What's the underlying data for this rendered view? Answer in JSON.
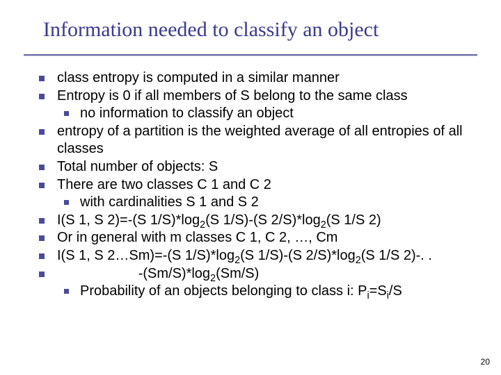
{
  "title": "Information needed to classify an object",
  "bullets": {
    "b1": "class entropy is computed in a similar manner",
    "b2": "Entropy is 0 if all members of S belong to the same class",
    "b2a": "no information to classify an object",
    "b3": "entropy of a partition is the weighted average of all entropies of all classes",
    "b4": "Total number of objects: S",
    "b5": "There are two classes C 1 and C 2",
    "b5a": "with cardinalities S 1 and S 2",
    "b6_html": "I(S 1, S 2)=-(S 1/S)*log<span class=\"sub\">2</span>(S 1/S)-(S 2/S)*log<span class=\"sub\">2</span>(S 1/S 2)",
    "b7": "Or in general with m classes C 1, C 2, …, Cm",
    "b8_html": "I(S 1, S 2…Sm)=-(S 1/S)*log<span class=\"sub\">2</span>(S 1/S)-(S 2/S)*log<span class=\"sub\">2</span>(S 1/S 2)-. .",
    "b9_html": "                     -(Sm/S)*log<span class=\"sub\">2</span>(Sm/S)",
    "b9a_html": "Probability of an objects belonging to class i: P<span class=\"sub\">i</span>=S<span class=\"sub\">i</span>/S"
  },
  "page_number": "20"
}
